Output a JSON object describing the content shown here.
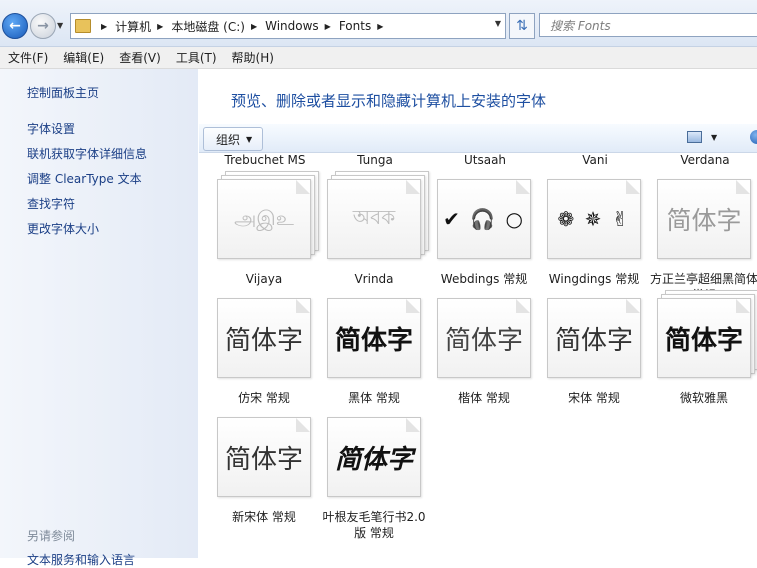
{
  "address": {
    "crumbs": [
      "计算机",
      "本地磁盘 (C:)",
      "Windows",
      "Fonts"
    ],
    "search_placeholder": "搜索 Fonts"
  },
  "menu": [
    "文件(F)",
    "编辑(E)",
    "查看(V)",
    "工具(T)",
    "帮助(H)"
  ],
  "sidebar": {
    "home": "控制面板主页",
    "links": [
      "字体设置",
      "联机获取字体详细信息",
      "调整 ClearType 文本",
      "查找字符",
      "更改字体大小"
    ],
    "see_also": "另请参阅",
    "see_also_item": "文本服务和输入语言"
  },
  "main": {
    "title": "预览、删除或者显示和隐藏计算机上安装的字体",
    "organize": "组织"
  },
  "top_row_labels": [
    "Trebuchet MS",
    "Tunga",
    "Utsaah",
    "Vani",
    "Verdana"
  ],
  "fonts": [
    {
      "name": "Vijaya",
      "sample": "அஇஉ",
      "style": "hidden"
    },
    {
      "name": "Vrinda",
      "sample": "অবক",
      "style": "hidden"
    },
    {
      "name": "Webdings 常规",
      "sample": "✔ 🎧 ○",
      "style": "symbol"
    },
    {
      "name": "Wingdings 常规",
      "sample": "❁ ✵ ✌",
      "style": "symbol"
    },
    {
      "name": "方正兰亭超细黑简体 常规",
      "sample": "简体字",
      "style": "thin"
    },
    {
      "name": "仿宋 常规",
      "sample": "简体字",
      "style": "song"
    },
    {
      "name": "黑体 常规",
      "sample": "简体字",
      "style": "hei"
    },
    {
      "name": "楷体 常规",
      "sample": "简体字",
      "style": "kai"
    },
    {
      "name": "宋体 常规",
      "sample": "简体字",
      "style": "song"
    },
    {
      "name": "微软雅黑",
      "sample": "简体字",
      "style": "yahei"
    },
    {
      "name": "新宋体 常规",
      "sample": "简体字",
      "style": "song"
    },
    {
      "name": "叶根友毛笔行书2.0版 常规",
      "sample": "简体字",
      "style": "brush"
    }
  ]
}
